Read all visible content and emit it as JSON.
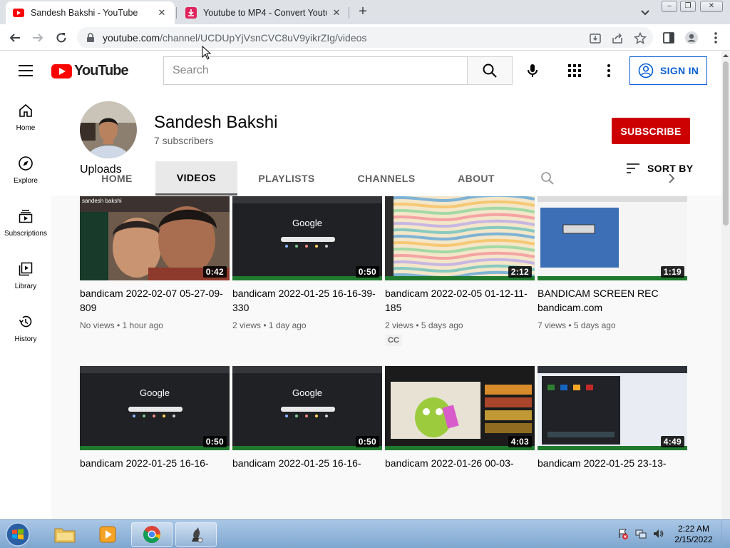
{
  "browser": {
    "tabs": [
      {
        "title": "Sandesh Bakshi - YouTube",
        "active": true
      },
      {
        "title": "Youtube to MP4 - Convert Youtub",
        "active": false
      }
    ],
    "url_host": "youtube.com",
    "url_path": "/channel/UCDUpYjVsnCVC8uV9yikrZIg/videos"
  },
  "masthead": {
    "logo_text": "YouTube",
    "search_placeholder": "Search",
    "signin_label": "SIGN IN"
  },
  "guide": {
    "items": [
      {
        "label": "Home",
        "icon": "home-icon"
      },
      {
        "label": "Explore",
        "icon": "compass-icon"
      },
      {
        "label": "Subscriptions",
        "icon": "subscriptions-icon"
      },
      {
        "label": "Library",
        "icon": "library-icon"
      },
      {
        "label": "History",
        "icon": "history-icon"
      }
    ]
  },
  "channel": {
    "name": "Sandesh Bakshi",
    "subscribers": "7 subscribers",
    "subscribe_label": "SUBSCRIBE",
    "tabs": [
      "HOME",
      "VIDEOS",
      "PLAYLISTS",
      "CHANNELS",
      "ABOUT"
    ],
    "active_tab": "VIDEOS"
  },
  "section": {
    "title": "Uploads",
    "sort_label": "SORT BY"
  },
  "videos": [
    {
      "title": "bandicam 2022-02-07 05-27-09-809",
      "duration": "0:42",
      "meta": "No views • 1 hour ago",
      "thumb": "selfie",
      "cc": "",
      "overlay": "sandesh bakshi"
    },
    {
      "title": "bandicam 2022-01-25 16-16-39-330",
      "duration": "0:50",
      "meta": "2 views • 1 day ago",
      "thumb": "google-dark",
      "cc": "",
      "overlay": "Google"
    },
    {
      "title": "bandicam 2022-02-05 01-12-11-185",
      "duration": "2:12",
      "meta": "2 views • 5 days ago",
      "thumb": "waves",
      "cc": "CC",
      "overlay": ""
    },
    {
      "title": "BANDICAM SCREEN REC bandicam.com",
      "duration": "1:19",
      "meta": "7 views • 5 days ago",
      "thumb": "blue-window",
      "cc": "",
      "overlay": ""
    },
    {
      "title": "bandicam 2022-01-25 16-16-",
      "duration": "0:50",
      "meta": "",
      "thumb": "google-dark",
      "cc": "",
      "overlay": "Google"
    },
    {
      "title": "bandicam 2022-01-25 16-16-",
      "duration": "0:50",
      "meta": "",
      "thumb": "google-dark",
      "cc": "",
      "overlay": "Google"
    },
    {
      "title": "bandicam 2022-01-26 00-03-",
      "duration": "4:03",
      "meta": "",
      "thumb": "youtube-pear",
      "cc": "",
      "overlay": ""
    },
    {
      "title": "bandicam 2022-01-25 23-13-",
      "duration": "4:49",
      "meta": "",
      "thumb": "dark-app",
      "cc": "",
      "overlay": ""
    }
  ],
  "taskbar": {
    "time": "2:22 AM",
    "date": "2/15/2022"
  },
  "colors": {
    "youtube_red": "#ff0000",
    "subscribe_red": "#cc0000",
    "signin_blue": "#065fd4"
  }
}
